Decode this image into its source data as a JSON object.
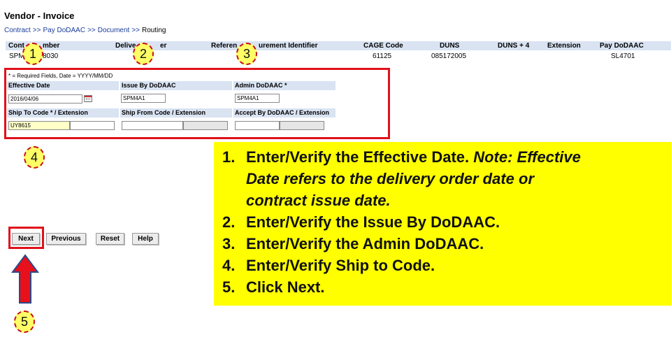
{
  "page": {
    "title": "Vendor - Invoice"
  },
  "breadcrumb": [
    "Contract",
    "Pay DoDAAC",
    "Document",
    "Routing"
  ],
  "breadcrumb_sep": ">>",
  "contract_table": {
    "columns": [
      "Contract Number",
      "Delivery Order",
      "Reference Procurement Identifier",
      "CAGE Code",
      "DUNS",
      "DUNS + 4",
      "Extension",
      "Pay DoDAAC"
    ],
    "visible_headers": [
      "Cont",
      "mber",
      "Delive",
      "er",
      "Referen",
      "urement Identifier",
      "CAGE Code",
      "DUNS",
      "DUNS + 4",
      "Extension",
      "Pay DoDAAC"
    ],
    "visible_values": [
      "SPM",
      "8030",
      "61125",
      "085172005",
      "SL4701"
    ]
  },
  "form": {
    "required_note": "* = Required Fields, Date = YYYY/MM/DD",
    "effective_date_label": "Effective Date",
    "effective_date_value": "2016/04/06",
    "issue_by_label": "Issue By DoDAAC",
    "issue_by_value": "SPM4A1",
    "admin_label": "Admin DoDAAC *",
    "admin_value": "SPM4A1",
    "ship_to_label": "Ship To Code * / Extension",
    "ship_to_value": "UY8615",
    "ship_from_label": "Ship From Code / Extension",
    "accept_by_label": "Accept By DoDAAC / Extension"
  },
  "buttons": {
    "next": "Next",
    "previous": "Previous",
    "reset": "Reset",
    "help": "Help"
  },
  "markers": [
    "1",
    "2",
    "3",
    "4",
    "5"
  ],
  "instructions": {
    "step1_num": "1.",
    "step1_text": "Enter/Verify the Effective Date. ",
    "step1_note": "Note: Effective",
    "step1_note_line2": "Date refers to the delivery order date or",
    "step1_note_line3": "contract issue date.",
    "step2_num": "2.",
    "step2_text": "Enter/Verify the Issue By DoDAAC.",
    "step3_num": "3.",
    "step3_text": "Enter/Verify the Admin DoDAAC.",
    "step4_num": "4.",
    "step4_text": "Enter/Verify Ship to Code.",
    "step5_num": "5.",
    "step5_text": "Click Next."
  },
  "colors": {
    "highlight_red": "#e0111b",
    "callout_yellow": "#ffff00",
    "header_blue": "#d9e3f2",
    "link_blue": "#1a3d9c"
  }
}
